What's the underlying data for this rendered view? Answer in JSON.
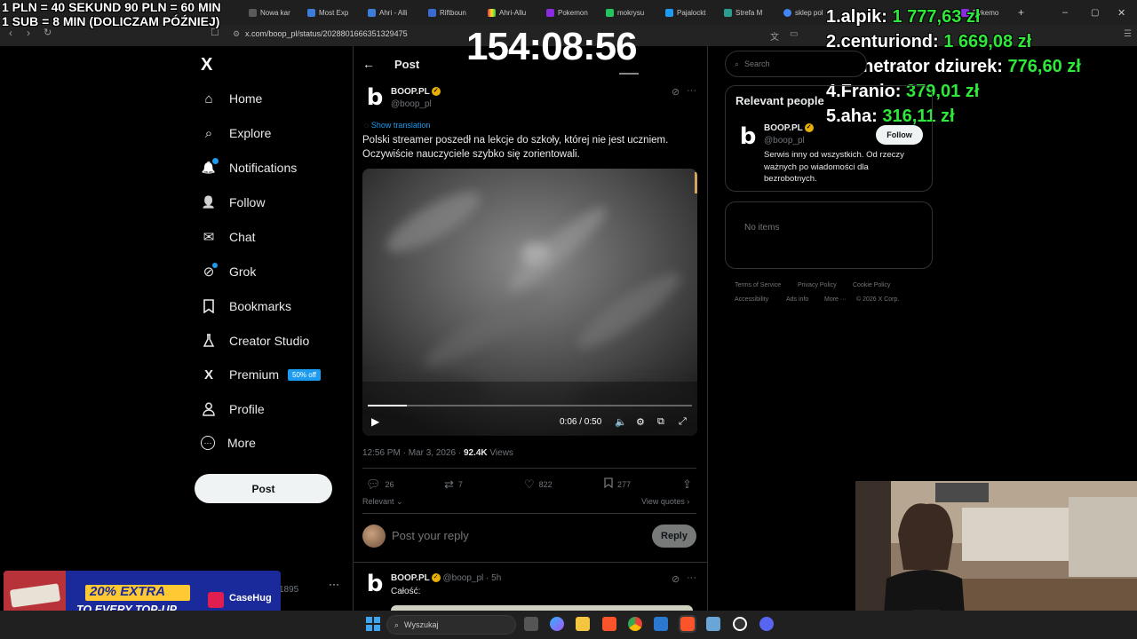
{
  "browser": {
    "tabs": [
      "Nowa kar",
      "Most Exp",
      "Ahri - Alli",
      "Riftboun",
      "Ahri-Allu",
      "Pokemon",
      "mokrysu",
      "Pajalockt",
      "Strefa M",
      "sklep pol",
      "Pokemo"
    ],
    "url": "x.com/boop_pl/status/2028801666351329475"
  },
  "overlay": {
    "rate_line1": "1 PLN =  40 SEKUND 90 PLN = 60 MIN",
    "rate_line2": "1 SUB = 8 MIN (DOLICZAM PÓŹNIEJ)",
    "timer": "154:08:56",
    "leaderboard": [
      {
        "name": "1.alpik:",
        "amount": "1 777,63 zł"
      },
      {
        "name": "2.centuriond:",
        "amount": "1 669,08 zł"
      },
      {
        "name": "3.Penetrator dziurek:",
        "amount": "776,60 zł"
      },
      {
        "name": "4.Franio:",
        "amount": "379,01 zł"
      },
      {
        "name": "5.aha:",
        "amount": "316,11 zł"
      }
    ]
  },
  "sidebar": {
    "logo": "X",
    "items": [
      {
        "label": "Home",
        "icon": "⌂"
      },
      {
        "label": "Explore",
        "icon": "⌕"
      },
      {
        "label": "Notifications",
        "icon": "🔔"
      },
      {
        "label": "Follow",
        "icon": "👤"
      },
      {
        "label": "Chat",
        "icon": "✉"
      },
      {
        "label": "Grok",
        "icon": "⊘"
      },
      {
        "label": "Bookmarks",
        "icon": "🔖"
      },
      {
        "label": "Creator Studio",
        "icon": "⚲"
      },
      {
        "label": "Premium",
        "icon": "X"
      },
      {
        "label": "Profile",
        "icon": "👤"
      },
      {
        "label": "More",
        "icon": "⋯"
      }
    ],
    "premium_badge": "50% off",
    "post_button": "Post",
    "account_suffix": "1895"
  },
  "post": {
    "header": "Post",
    "author_name": "BOOP.PL",
    "author_handle": "@boop_pl",
    "show_translation": "Show translation",
    "text": "Polski streamer poszedł na lekcje do szkoły, której nie jest uczniem. Oczywiście nauczyciele szybko się zorientowali.",
    "video": {
      "time": "0:06 / 0:50",
      "progress": 0.12
    },
    "time": "12:56 PM · Mar 3, 2026 · ",
    "views_count": "92.4K",
    "views_label": " Views",
    "actions": {
      "replies": "26",
      "reposts": "7",
      "likes": "822",
      "bookmarks": "277"
    },
    "relevant": "Relevant ⌄",
    "view_quotes": "View quotes ›",
    "reply_placeholder": "Post your reply",
    "reply_button": "Reply",
    "reply_tweet": {
      "name": "BOOP.PL",
      "handle": "@boop_pl · 5h",
      "text": "Całość:"
    }
  },
  "right": {
    "search_placeholder": "Search",
    "relevant_title": "Relevant people",
    "person_name": "BOOP.PL",
    "person_handle": "@boop_pl",
    "follow": "Follow",
    "bio": "Serwis inny od wszystkich. Od rzeczy ważnych po wiadomości dla bezrobotnych.",
    "no_items": "No items",
    "footer": [
      "Terms of Service",
      "Privacy Policy",
      "Cookie Policy",
      "Accessibility",
      "Ads info",
      "More ···",
      "© 2026 X Corp."
    ]
  },
  "taskbar": {
    "search": "Wyszukaj"
  },
  "ad": {
    "line1": "20% EXTRA",
    "line2": "TO EVERY TOP-UP",
    "brand": "CaseHug"
  }
}
